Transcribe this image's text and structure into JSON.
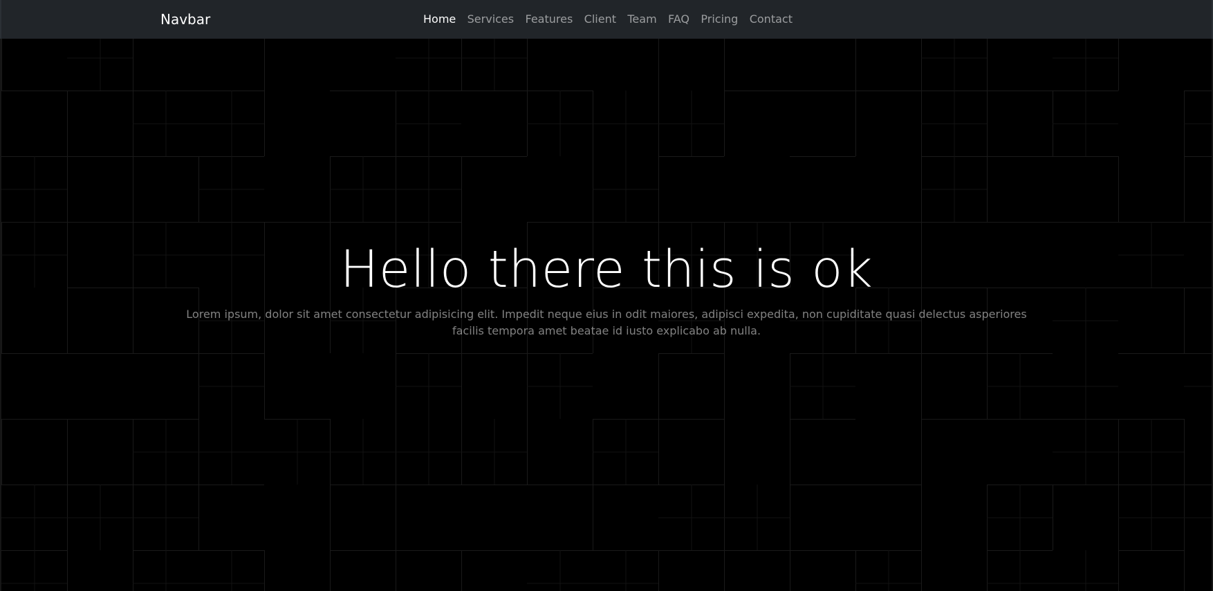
{
  "navbar": {
    "brand": "Navbar",
    "links": [
      {
        "label": "Home",
        "active": true
      },
      {
        "label": "Services",
        "active": false
      },
      {
        "label": "Features",
        "active": false
      },
      {
        "label": "Client",
        "active": false
      },
      {
        "label": "Team",
        "active": false
      },
      {
        "label": "FAQ",
        "active": false
      },
      {
        "label": "Pricing",
        "active": false
      },
      {
        "label": "Contact",
        "active": false
      }
    ]
  },
  "hero": {
    "title": "Hello there this is ok",
    "description": "Lorem ipsum, dolor sit amet consectetur adipisicing elit. Impedit neque eius in odit maiores, adipisci expedita, non cupiditate quasi delectus asperiores facilis tempora amet beatae id iusto explicabo ab nulla."
  },
  "colors": {
    "navbar_bg": "#212529",
    "hero_bg": "#000000",
    "grid_line": "#1a1a1a",
    "link_active": "#ffffff",
    "link_inactive": "#8c8e90"
  }
}
